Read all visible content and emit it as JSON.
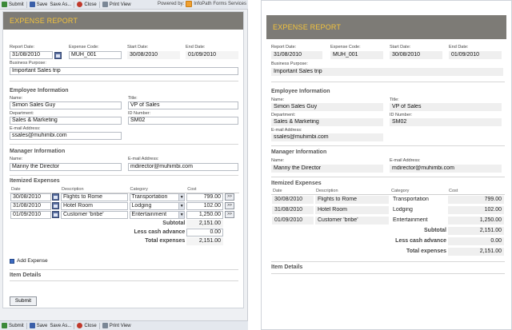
{
  "toolbar": {
    "submit": "Submit",
    "save": "Save",
    "save_as": "Save As...",
    "close": "Close",
    "print_view": "Print View",
    "powered_by": "Powered by:",
    "product": "InfoPath Forms Services"
  },
  "form": {
    "title": "EXPENSE REPORT",
    "labels": {
      "report_date": "Report Date:",
      "expense_code": "Expense Code:",
      "start_date": "Start Date:",
      "end_date": "End Date:",
      "business_purpose": "Business Purpose:",
      "name": "Name:",
      "title": "Title:",
      "department": "Department:",
      "id_number": "ID Number:",
      "email": "E-mail Address:"
    },
    "report_date": "31/08/2010",
    "expense_code": "MUH_001",
    "start_date": "30/08/2010",
    "end_date": "01/09/2010",
    "business_purpose": "Important Sales trip",
    "employee": {
      "heading": "Employee Information",
      "name": "Simon Sales Guy",
      "title": "VP of Sales",
      "department": "Sales & Marketing",
      "id_number": "SM02",
      "email": "ssales@muhimbi.com"
    },
    "manager": {
      "heading": "Manager Information",
      "name": "Manny the Director",
      "email": "mdirector@muhimbi.com"
    },
    "expenses": {
      "heading": "Itemized Expenses",
      "columns": [
        "Date",
        "Description",
        "Category",
        "Cost"
      ],
      "rows": [
        {
          "date": "30/08/2010",
          "description": "Flights to Rome",
          "category": "Transportation",
          "cost": "799.00"
        },
        {
          "date": "31/08/2010",
          "description": "Hotel Room",
          "category": "Lodging",
          "cost": "102.00"
        },
        {
          "date": "01/09/2010",
          "description": "Customer 'bribe'",
          "category": "Entertainment",
          "cost": "1,250.00"
        }
      ],
      "subtotal_label": "Subtotal",
      "subtotal": "2,151.00",
      "advance_label": "Less cash advance",
      "advance": "0.00",
      "total_label": "Total expenses",
      "total": "2,151.00",
      "push_label": ">>",
      "add_label": "Add Expense"
    },
    "item_details": "Item Details",
    "submit_label": "Submit"
  }
}
